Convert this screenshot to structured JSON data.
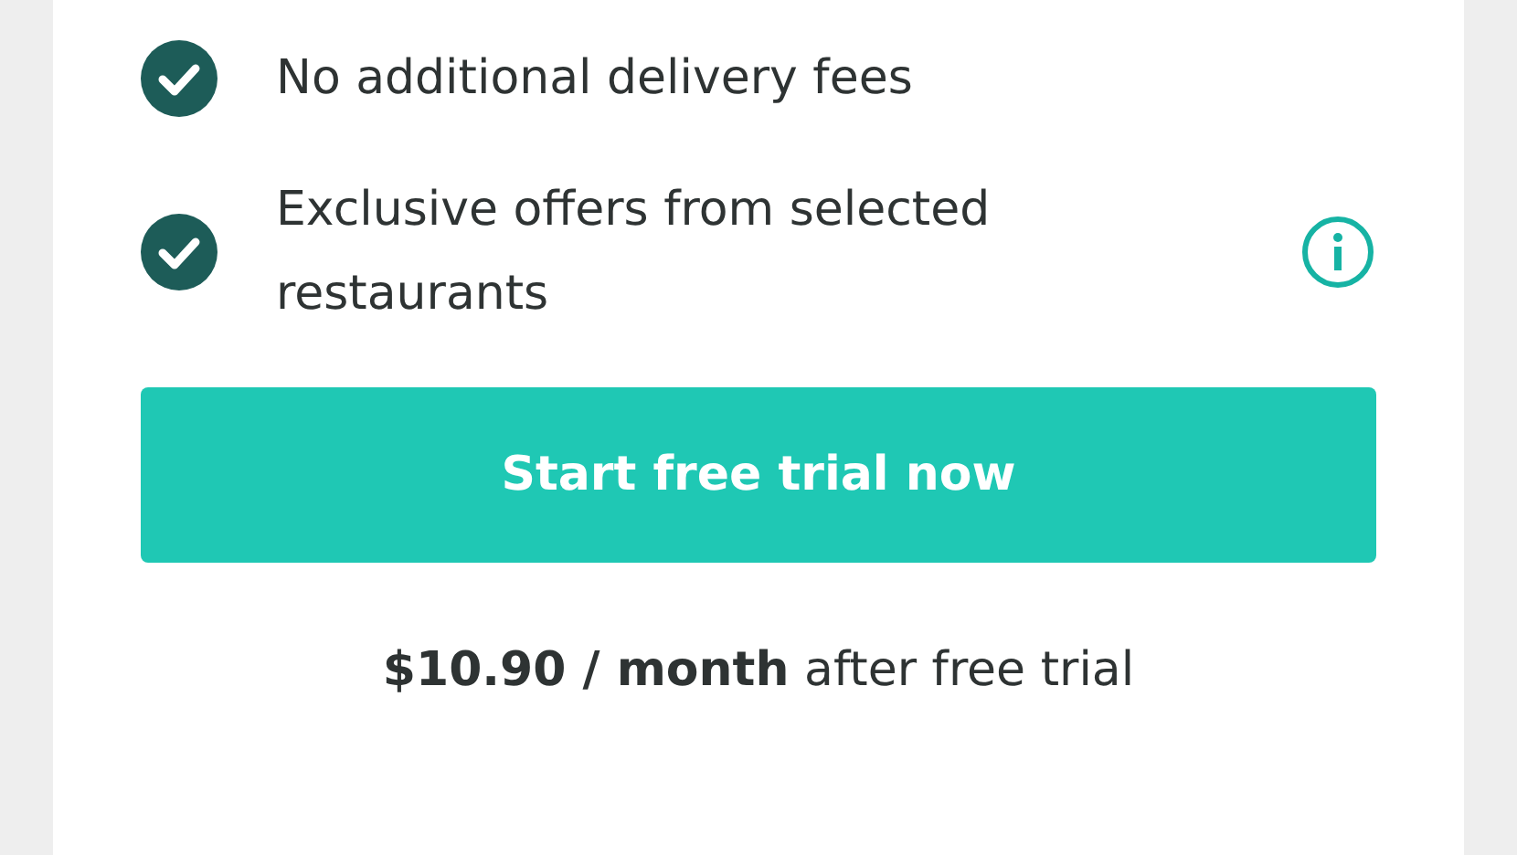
{
  "features": [
    {
      "text": "No additional delivery fees",
      "checked": true,
      "info": false
    },
    {
      "text": "Exclusive offers from selected restaurants",
      "checked": true,
      "info": true
    }
  ],
  "button": {
    "label": "Start free trial now"
  },
  "price_note": "**$10.90 / month** after free trial"
}
